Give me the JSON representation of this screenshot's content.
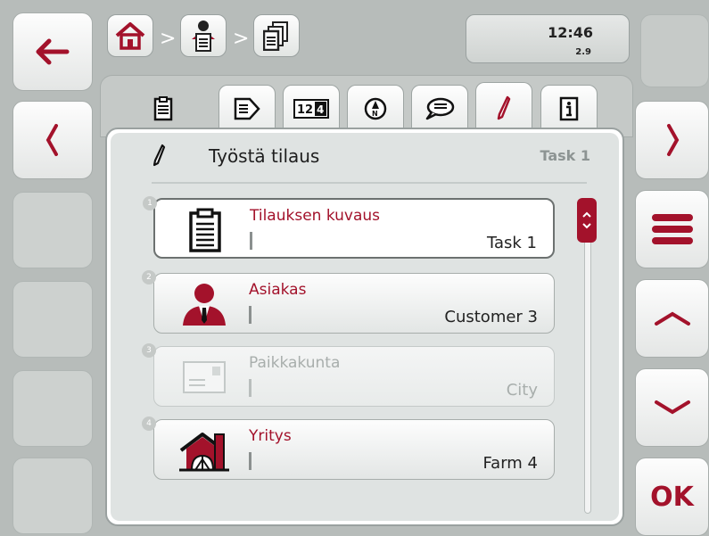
{
  "header": {
    "breadcrumb": [
      {
        "icon": "home-icon"
      },
      {
        "icon": "user-clipboard-icon"
      },
      {
        "icon": "documents-icon"
      }
    ],
    "separator": ">",
    "time": "12:46",
    "version": "2.9"
  },
  "tabs": [
    {
      "icon": "clipboard-icon",
      "name": "tab-overview"
    },
    {
      "icon": "task-arrow-icon",
      "name": "tab-task-data"
    },
    {
      "icon": "counter-icon",
      "name": "tab-counters"
    },
    {
      "icon": "compass-icon",
      "name": "tab-navigation"
    },
    {
      "icon": "comment-icon",
      "name": "tab-notes"
    },
    {
      "icon": "pen-icon",
      "name": "tab-edit",
      "active": true
    },
    {
      "icon": "info-icon",
      "name": "tab-info"
    }
  ],
  "panel": {
    "title": "Työstä tilaus",
    "task": "Task 1"
  },
  "rows": [
    {
      "num": "1",
      "label": "Tilauksen kuvaus",
      "value": "Task 1",
      "icon": "clipboard-icon",
      "state": "selected"
    },
    {
      "num": "2",
      "label": "Asiakas",
      "value": "Customer 3",
      "icon": "customer-icon",
      "state": "normal"
    },
    {
      "num": "3",
      "label": "Paikkakunta",
      "value": "City",
      "icon": "envelope-icon",
      "state": "disabled"
    },
    {
      "num": "4",
      "label": "Yritys",
      "value": "Farm 4",
      "icon": "farm-icon",
      "state": "normal"
    }
  ],
  "softkeys": {
    "ok": "OK"
  },
  "colors": {
    "accent": "#a3122b",
    "background": "#b7bcba"
  }
}
